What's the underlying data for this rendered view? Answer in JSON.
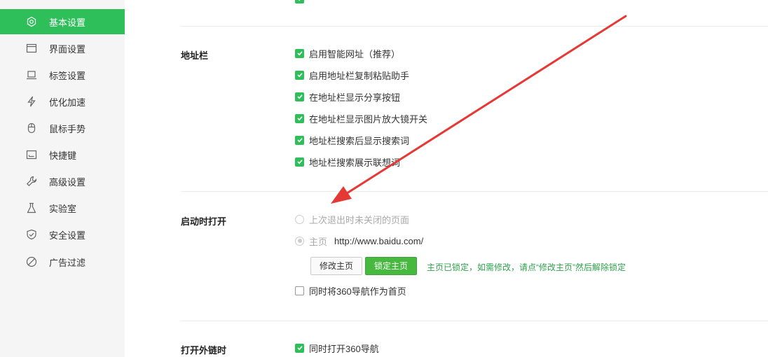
{
  "sidebar": {
    "items": [
      {
        "label": "基本设置",
        "icon": "gear-icon",
        "active": true
      },
      {
        "label": "界面设置",
        "icon": "window-icon"
      },
      {
        "label": "标签设置",
        "icon": "tab-icon"
      },
      {
        "label": "优化加速",
        "icon": "lightning-icon"
      },
      {
        "label": "鼠标手势",
        "icon": "mouse-icon"
      },
      {
        "label": "快捷键",
        "icon": "keyboard-icon"
      },
      {
        "label": "高级设置",
        "icon": "wrench-icon"
      },
      {
        "label": "实验室",
        "icon": "flask-icon"
      },
      {
        "label": "安全设置",
        "icon": "shield-icon"
      },
      {
        "label": "广告过滤",
        "icon": "block-icon"
      }
    ]
  },
  "address_bar": {
    "title": "地址栏",
    "options": [
      {
        "label": "启用智能网址（推荐）",
        "checked": true
      },
      {
        "label": "启用地址栏复制粘贴助手",
        "checked": true
      },
      {
        "label": "在地址栏显示分享按钮",
        "checked": true
      },
      {
        "label": "在地址栏显示图片放大镜开关",
        "checked": true
      },
      {
        "label": "地址栏搜索后显示搜索词",
        "checked": true
      },
      {
        "label": "地址栏搜索展示联想词",
        "checked": true
      }
    ]
  },
  "startup": {
    "title": "启动时打开",
    "radio_last_session": "上次退出时未关闭的页面",
    "radio_home": "主页",
    "home_url": "http://www.baidu.com/",
    "modify_button": "修改主页",
    "lock_button": "锁定主页",
    "lock_note": "主页已锁定，如需修改，请点“修改主页”然后解除锁定",
    "nav_checkbox": "同时将360导航作为首页"
  },
  "external_link": {
    "title": "打开外链时",
    "option": "同时打开360导航"
  },
  "colors": {
    "accent": "#2fbf5a",
    "arrow": "#e53935"
  }
}
